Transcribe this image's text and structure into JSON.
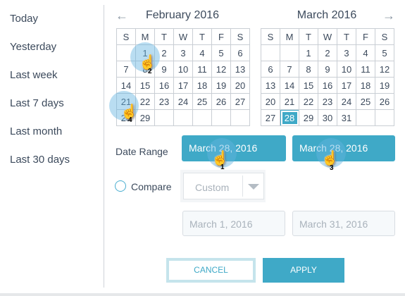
{
  "sidebar": {
    "items": [
      {
        "label": "Today"
      },
      {
        "label": "Yesterday"
      },
      {
        "label": "Last week"
      },
      {
        "label": "Last 7 days"
      },
      {
        "label": "Last month"
      },
      {
        "label": "Last 30 days"
      }
    ]
  },
  "calendar": {
    "prev_icon": "arrow-left-icon",
    "next_icon": "arrow-right-icon",
    "weekdays": [
      "S",
      "M",
      "T",
      "W",
      "T",
      "F",
      "S"
    ],
    "months": [
      {
        "title": "February 2016",
        "weeks": [
          [
            "",
            "1",
            "2",
            "3",
            "4",
            "5",
            "6"
          ],
          [
            "7",
            "8",
            "9",
            "10",
            "11",
            "12",
            "13"
          ],
          [
            "14",
            "15",
            "16",
            "17",
            "18",
            "19",
            "20"
          ],
          [
            "21",
            "22",
            "23",
            "24",
            "25",
            "26",
            "27"
          ],
          [
            "28",
            "29",
            "",
            "",
            "",
            "",
            ""
          ]
        ]
      },
      {
        "title": "March 2016",
        "selected": "28",
        "weeks": [
          [
            "",
            "",
            "1",
            "2",
            "3",
            "4",
            "5"
          ],
          [
            "6",
            "7",
            "8",
            "9",
            "10",
            "11",
            "12"
          ],
          [
            "13",
            "14",
            "15",
            "16",
            "17",
            "18",
            "19"
          ],
          [
            "20",
            "21",
            "22",
            "23",
            "24",
            "25",
            "26"
          ],
          [
            "27",
            "28",
            "29",
            "30",
            "31",
            "",
            ""
          ]
        ]
      }
    ]
  },
  "form": {
    "date_range_label": "Date Range",
    "start": "March 28, 2016",
    "end": "March 28, 2016",
    "compare_label": "Compare",
    "compare_select": "Custom",
    "compare_start_placeholder": "March 1, 2016",
    "compare_end_placeholder": "March 31, 2016"
  },
  "buttons": {
    "cancel": "CANCEL",
    "apply": "APPLY"
  },
  "annotations": [
    "1",
    "2",
    "3",
    "4"
  ],
  "colors": {
    "accent": "#3fa9c7",
    "text": "#3c4a5c"
  }
}
